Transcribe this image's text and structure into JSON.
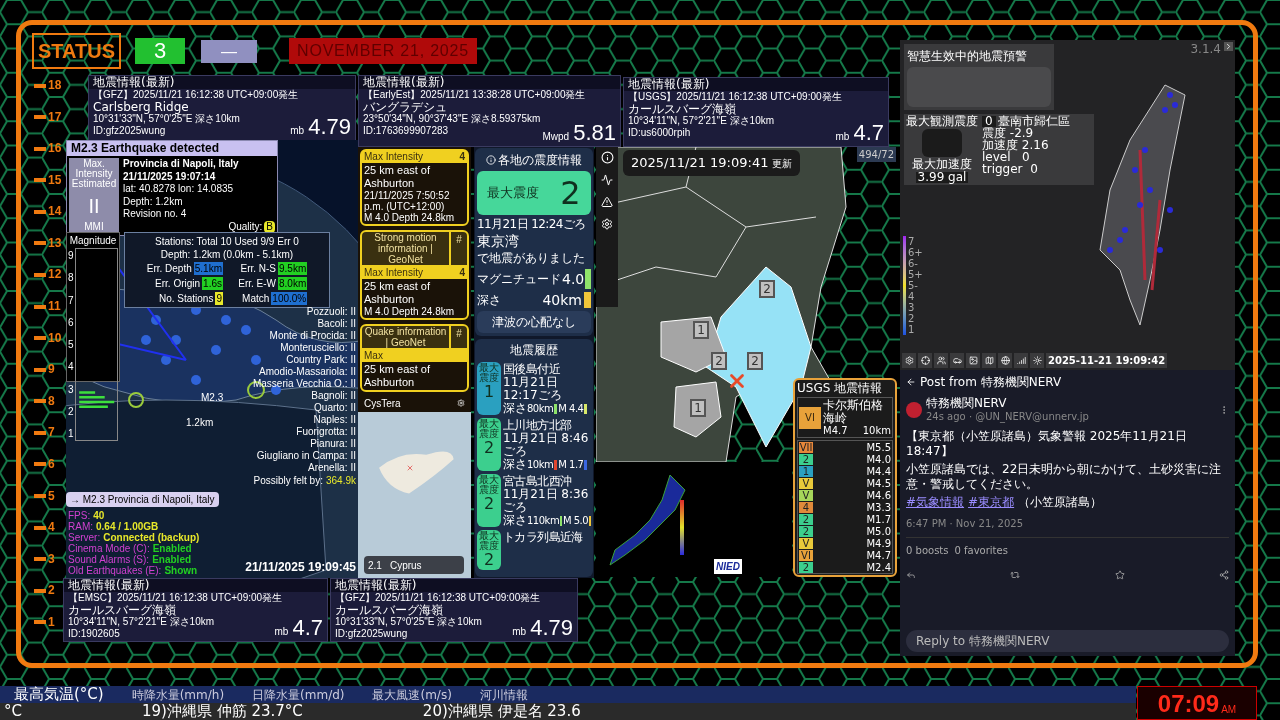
{
  "status_bar": {
    "label": "STATUS",
    "level_value": "3",
    "mode": "—",
    "date": "NOVEMBER 21, 2025"
  },
  "scale": [
    "18",
    "17",
    "16",
    "15",
    "14",
    "13",
    "12",
    "11",
    "10",
    "9",
    "8",
    "7",
    "6",
    "5",
    "4",
    "3",
    "2",
    "1"
  ],
  "quake_cards": [
    {
      "heading": "地震情報(最新)",
      "source": "【GFZ】2025/11/21  16:12:38  UTC+09:00発生",
      "region": "Carlsberg Ridge",
      "coords": "10°31'33\"N,  57°0'25\"E   深さ10km",
      "id": "ID:gfz2025wung",
      "mag_type": "mb",
      "mag": "4.79"
    },
    {
      "heading": "地震情報(最新)",
      "source": "【EarlyEst】2025/11/21  13:38:28  UTC+09:00発生",
      "region": "バングラデシュ",
      "coords": "23°50'34\"N,  90°37'43\"E   深さ8.59375km",
      "id": "ID:1763699907283",
      "mag_type": "Mwpd",
      "mag": "5.81"
    },
    {
      "heading": "地震情報(最新)",
      "source": "【USGS】2025/11/21  16:12:38  UTC+09:00発生",
      "region": "カールスバーグ海嶺",
      "coords": "10°34'11\"N,  57°2'21\"E   深さ10km",
      "id": "ID:us6000rpih",
      "mag_type": "mb",
      "mag": "4.7"
    },
    {
      "heading": "地震情報(最新)",
      "source": "【EMSC】2025/11/21  16:12:38  UTC+09:00発生",
      "region": "カールスバーグ海嶺",
      "coords": "10°34'11\"N,  57°2'21\"E   深さ10km",
      "id": "ID:1902605",
      "mag_type": "mb",
      "mag": "4.7"
    },
    {
      "heading": "地震情報(最新)",
      "source": "【GFZ】2025/11/21  16:12:38  UTC+09:00発生",
      "region": "カールスバーグ海嶺",
      "coords": "10°31'33\"N,  57°0'25\"E   深さ10km",
      "id": "ID:gfz2025wung",
      "mag_type": "mb",
      "mag": "4.79"
    }
  ],
  "globe": {
    "title": "M2.3 Earthquake detected",
    "intensity_label": "Max. Intensity Estimated",
    "intensity": "II",
    "intensity_unit": "MMI",
    "place": "Provincia di Napoli, Italy",
    "time": "21/11/2025 19:07:14",
    "latlon": "lat: 40.8278 lon: 14.0835",
    "depth": "Depth: 1.2km",
    "revision": "Revision no. 4",
    "quality_label": "Quality:",
    "quality": "B",
    "stations_line": "Stations: Total 10 Used 9/9 Err 0",
    "depth_range": "Depth: 1.2km (0.0km - 5.1km)",
    "errors": [
      {
        "label": "Err. Depth",
        "value": "5.1km",
        "color": "#1f6fd0"
      },
      {
        "label": "Err. N-S",
        "value": "9.5km",
        "color": "#22d022"
      },
      {
        "label": "Err. Origin",
        "value": "1.6s",
        "color": "#22d022"
      },
      {
        "label": "Err. E-W",
        "value": "8.0km",
        "color": "#22d022"
      },
      {
        "label": "No. Stations",
        "value": "9",
        "color": "#e8e82a"
      },
      {
        "label": "Match",
        "value": "100.0%",
        "color": "#1f6fd0"
      }
    ],
    "magnitude_label": "Magnitude",
    "magnitude_ticks": [
      "9",
      "8",
      "7",
      "6",
      "5",
      "4",
      "3",
      "2",
      "1"
    ],
    "places": [
      {
        "name": "Pozzuoli:",
        "value": "II"
      },
      {
        "name": "Bacoli:",
        "value": "II"
      },
      {
        "name": "Monte di Procida:",
        "value": "II"
      },
      {
        "name": "Monterusciello:",
        "value": "II"
      },
      {
        "name": "Country Park:",
        "value": "II"
      },
      {
        "name": "Amodio-Massariola:",
        "value": "II"
      },
      {
        "name": "Masseria Vecchia O.:",
        "value": "II"
      },
      {
        "name": "Bagnoli:",
        "value": "II"
      },
      {
        "name": "Quarto:",
        "value": "II"
      },
      {
        "name": "Naples:",
        "value": "II"
      },
      {
        "name": "Fuorigrotta:",
        "value": "II"
      },
      {
        "name": "Pianura:",
        "value": "II"
      },
      {
        "name": "Giugliano in Campa:",
        "value": "II"
      },
      {
        "name": "Arenella:",
        "value": "II"
      }
    ],
    "felt_label": "Possibly felt by:",
    "felt_value": "364.9k",
    "map_mag": "M2.3",
    "map_depth": "1.2km",
    "tag": "→ M2.3 Provincia di Napoli, Italy",
    "stats": [
      {
        "label": "FPS:",
        "value": "40",
        "color": "#e8e82a"
      },
      {
        "label": "RAM:",
        "value": "0.64 / 1.00GB",
        "color": "#e8e82a"
      },
      {
        "label": "Server:",
        "value": "Connected (backup)",
        "color": "#e8e82a"
      },
      {
        "label": "Cinema Mode (C):",
        "value": "Enabled",
        "color": "#22d022"
      },
      {
        "label": "Sound Alarms (S):",
        "value": "Enabled",
        "color": "#22d022"
      },
      {
        "label": "Old Earthquakes (E):",
        "value": "Shown",
        "color": "#22d022"
      }
    ],
    "timestamp": "21/11/2025 19:09:45"
  },
  "geonet": {
    "cards": [
      {
        "max_label": "Max Intensity",
        "max": "4",
        "place": "25 km east of Ashburton",
        "time": "21/11/2025 7:50:52 p.m. (UTC+12:00)",
        "detail": "M 4.0   Depth 24.8km"
      },
      {
        "header": "Strong motion information | GeoNet",
        "header_tag": "#",
        "max_label": "Max Intensity",
        "max": "4",
        "place": "25 km east of Ashburton",
        "detail": "M 4.0   Depth 24.8km"
      },
      {
        "header": "Quake information | GeoNet",
        "header_tag": "#",
        "max_label": "Max",
        "place": "25 km east of Ashburton"
      }
    ],
    "footer": "CysTera",
    "map_place": "Cyprus",
    "map_mag": "2.1"
  },
  "shindo": {
    "title": "各地の震度情報",
    "max_label": "最大震度",
    "max": "2",
    "time": "11月21日 12:24ごろ",
    "epicenter": "東京湾",
    "epicenter_note": "で地震がありました",
    "mag_label": "マグニチュード",
    "mag": "4.0",
    "mag_bar": {
      "color": "#8fe36a"
    },
    "depth_label": "深さ",
    "depth": "40km",
    "depth_bar": {
      "color": "#f0c53a"
    },
    "tsunami": "津波の心配なし",
    "history_title": "地震履歴",
    "history": [
      {
        "badge_label": "最大震度",
        "intensity": "1",
        "color": "#2aa0c0",
        "place": "国後島付近",
        "time": "11月21日 12:17ごろ",
        "depth_label": "深さ",
        "depth": "80km",
        "depth_bar": {
          "color": "#8fe36a"
        },
        "mag": "M 4.4",
        "mag_bar": {
          "color": "#d8e86a"
        }
      },
      {
        "badge_label": "最大震度",
        "intensity": "2",
        "color": "#3ccf8e",
        "place": "上川地方北部",
        "time": "11月21日 8:46ごろ",
        "depth_label": "深さ",
        "depth": "10km",
        "depth_bar": {
          "color": "#e0452f"
        },
        "mag": "M 1.7",
        "mag_bar": {
          "color": "#3a66e0"
        }
      },
      {
        "badge_label": "最大震度",
        "intensity": "2",
        "color": "#3ccf8e",
        "place": "宮古島北西沖",
        "time": "11月21日 8:36ごろ",
        "depth_label": "深さ",
        "depth": "110km",
        "depth_bar": {
          "color": "#8fe36a"
        },
        "mag": "M 5.0",
        "mag_bar": {
          "color": "#f0c53a"
        }
      },
      {
        "badge_label": "最大震度",
        "intensity": "2",
        "color": "#3ccf8e",
        "place": "トカラ列島近海"
      }
    ]
  },
  "kanto_map": {
    "updated": "2025/11/21  19:09:41",
    "updated_suffix": "更新",
    "corner": "494/72",
    "regions": [
      {
        "intensity": "2"
      },
      {
        "intensity": "1"
      },
      {
        "intensity": "2"
      },
      {
        "intensity": "2"
      },
      {
        "intensity": "1"
      }
    ]
  },
  "japan_map": {
    "logo": "NIED"
  },
  "usgs": {
    "title": "USGS 地震情報",
    "intensity": "VI",
    "place": "卡尔斯伯格海岭",
    "mag": "M4.7",
    "depth": "10km",
    "list": [
      {
        "intensity": "VII",
        "color": "#e8873a",
        "mag": "M5.5"
      },
      {
        "intensity": "2",
        "color": "#3ccf8e",
        "mag": "M4.0"
      },
      {
        "intensity": "1",
        "color": "#2aa0c0",
        "mag": "M4.4"
      },
      {
        "intensity": "V",
        "color": "#e8c93a",
        "mag": "M4.5"
      },
      {
        "intensity": "V",
        "color": "#a6d65a",
        "mag": "M4.6"
      },
      {
        "intensity": "4",
        "color": "#e08a3a",
        "mag": "M3.3"
      },
      {
        "intensity": "2",
        "color": "#3ccf8e",
        "mag": "M1.7"
      },
      {
        "intensity": "2",
        "color": "#3ccf8e",
        "mag": "M5.0"
      },
      {
        "intensity": "V",
        "color": "#e8c93a",
        "mag": "M4.9"
      },
      {
        "intensity": "VI",
        "color": "#e8a23a",
        "mag": "M4.7"
      },
      {
        "intensity": "2",
        "color": "#3ccf8e",
        "mag": "M2.4"
      }
    ]
  },
  "taiwan": {
    "warning_title": "智慧生效中的地震預警",
    "max_obs_label": "最大観測震度",
    "station_value": "0",
    "station_name": "臺南市歸仁區",
    "station_intensity": "震度 -2.9",
    "station_accel": "加速度 2.16",
    "level_line": "level   0",
    "trigger_line": "trigger  0",
    "max_accel_label": "最大加速度",
    "max_accel": "3.99 gal",
    "version": "3.1.4",
    "legend": [
      "7",
      "6+",
      "6-",
      "5+",
      "5-",
      "4",
      "3",
      "2",
      "1"
    ],
    "timestamp": "2025-11-21 19:09:42"
  },
  "post": {
    "title": "Post from 特務機関NERV",
    "author": "特務機関NERV",
    "meta": "24s ago · @UN_NERV@unnerv.jp",
    "headline": "【東京都（小笠原諸島）気象警報 2025年11月21日 18:47】",
    "body": "小笠原諸島では、22日未明から朝にかけて、土砂災害に注意・警戒してください。",
    "hashtags": [
      "#気象情報",
      "#東京都"
    ],
    "hashtag_note": "（小笠原諸島）",
    "date": "6:47 PM · Nov 21, 2025",
    "boosts": "0 boosts",
    "favorites": "0 favorites",
    "reply_placeholder": "Reply to 特務機関NERV"
  },
  "ticker": {
    "headers": [
      "最高気温(°C)",
      "時降水量(mm/h)",
      "日降水量(mm/d)",
      "最大風速(m/s)",
      "河川情報"
    ],
    "items": [
      "°C",
      "19)沖縄県 仲筋 23.7°C",
      "20)沖縄県 伊是名 23.6"
    ],
    "clock": "07:09",
    "clock_suffix": "AM"
  }
}
